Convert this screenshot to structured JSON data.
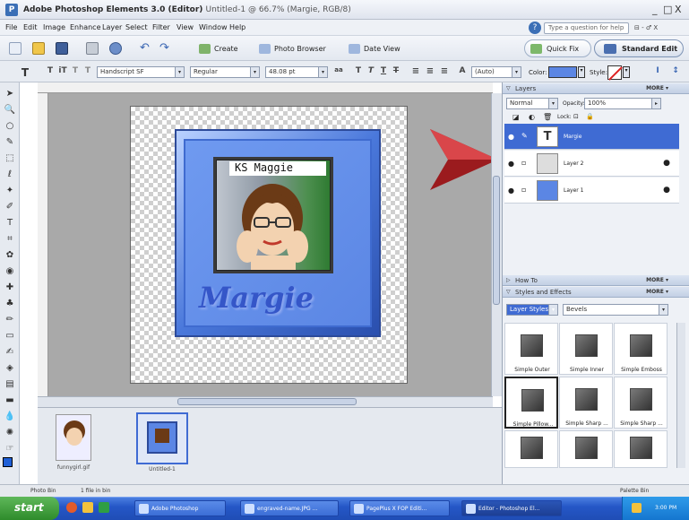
{
  "window": {
    "app_title": "Adobe Photoshop Elements 3.0 (Editor)",
    "doc_title": "Untitled-1 @ 66.7% (Margie, RGB/8)",
    "min": "_",
    "restore": "□",
    "close": "X"
  },
  "menu": [
    "File",
    "Edit",
    "Image",
    "Enhance",
    "Layer",
    "Select",
    "Filter",
    "View",
    "Window",
    "Help"
  ],
  "help": {
    "placeholder": "Type a question for help",
    "icon": "help-icon",
    "extra": "⊟ - ♂ X"
  },
  "toolbar": {
    "create_label": "Create",
    "photo_browser_label": "Photo Browser",
    "date_view_label": "Date View",
    "quick_fix_label": "Quick Fix",
    "standard_edit_label": "Standard Edit"
  },
  "options": {
    "font_family": "Handscript SF",
    "font_style": "Regular",
    "font_size": "48.08 pt",
    "aa": "aa",
    "leading": "(Auto)",
    "color_label": "Color:",
    "style_label": "Style:",
    "color": "#5b86e4"
  },
  "canvas": {
    "name_tag": "KS Maggie",
    "signature": "Margie"
  },
  "photobin": {
    "items": [
      {
        "caption": "funnygirl.gif"
      },
      {
        "caption": "Untitled-1"
      }
    ],
    "status_left": "Photo Bin",
    "status_mid": "1 file in bin",
    "status_right": "Palette Bin"
  },
  "layers_panel": {
    "title": "Layers",
    "more": "MORE ▾",
    "blend": "Normal",
    "opacity_label": "Opacity:",
    "opacity": "100%",
    "lock_label": "Lock:",
    "layers": [
      {
        "name": "Margie",
        "selected": true
      },
      {
        "name": "Layer 2",
        "selected": false
      },
      {
        "name": "Layer 1",
        "selected": false
      }
    ]
  },
  "howto_panel": {
    "title": "How To",
    "more": "MORE ▾"
  },
  "styles_panel": {
    "title": "Styles and Effects",
    "more": "MORE ▾",
    "category": "Layer Styles",
    "subcategory": "Bevels",
    "effects": [
      "Simple Outer",
      "Simple Inner",
      "Simple Emboss",
      "Simple Pillow...",
      "Simple Sharp ...",
      "Simple Sharp ...",
      "",
      "",
      ""
    ]
  },
  "taskbar": {
    "start": "start",
    "tasks": [
      "Adobe Photoshop",
      "engraved-name.JPG ...",
      "PagePlus X FOP Editi...",
      "Editor - Photoshop El..."
    ],
    "clock": "3:00 PM"
  }
}
